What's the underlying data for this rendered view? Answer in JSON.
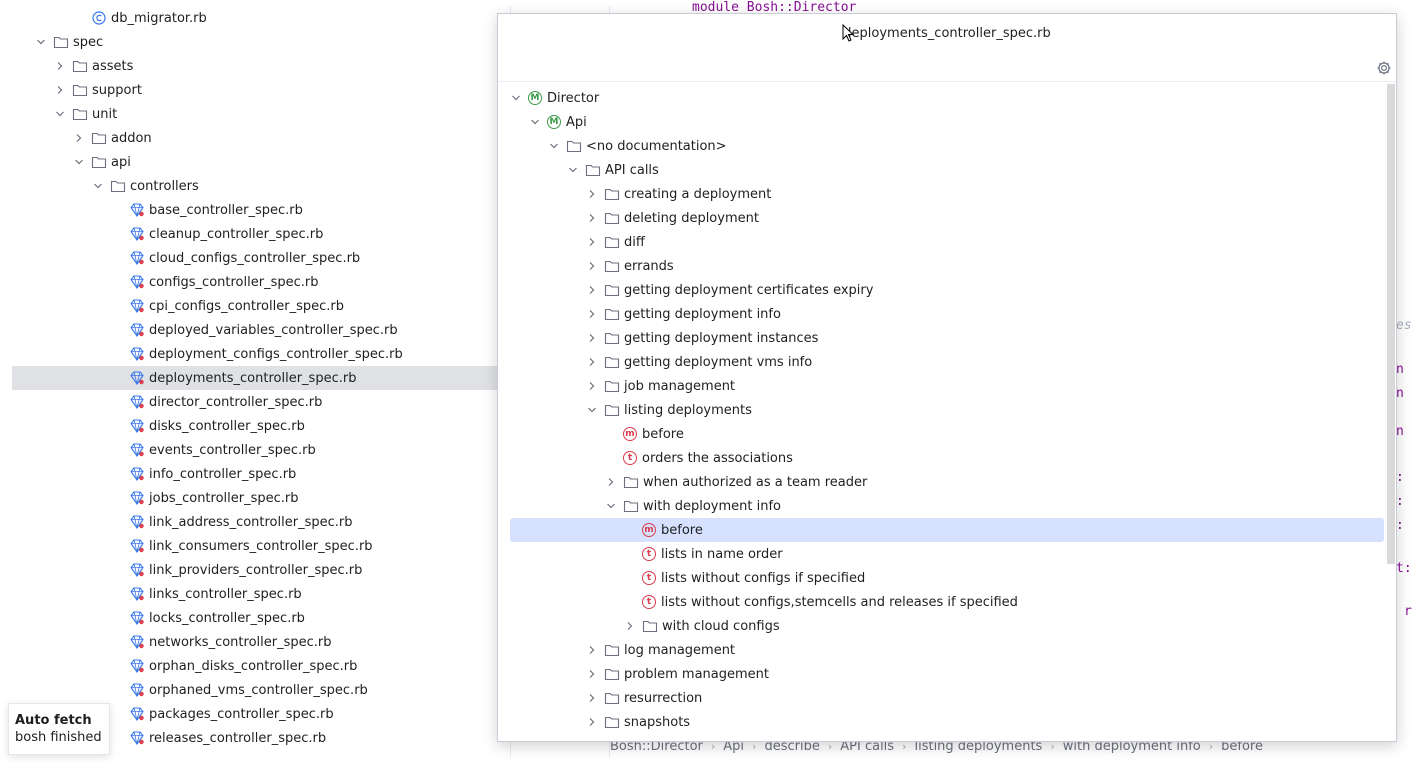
{
  "project_tree": {
    "rows": [
      {
        "label": "db_migrator.rb",
        "kind": "rb-class",
        "indent": 4,
        "chev": "none"
      },
      {
        "label": "spec",
        "kind": "folder",
        "indent": 2,
        "chev": "open"
      },
      {
        "label": "assets",
        "kind": "folder",
        "indent": 3,
        "chev": "closed"
      },
      {
        "label": "support",
        "kind": "folder",
        "indent": 3,
        "chev": "closed"
      },
      {
        "label": "unit",
        "kind": "folder",
        "indent": 3,
        "chev": "open"
      },
      {
        "label": "addon",
        "kind": "folder",
        "indent": 4,
        "chev": "closed"
      },
      {
        "label": "api",
        "kind": "folder",
        "indent": 4,
        "chev": "open"
      },
      {
        "label": "controllers",
        "kind": "folder",
        "indent": 5,
        "chev": "open"
      },
      {
        "label": "base_controller_spec.rb",
        "kind": "spec",
        "indent": 6,
        "chev": "none"
      },
      {
        "label": "cleanup_controller_spec.rb",
        "kind": "spec",
        "indent": 6,
        "chev": "none"
      },
      {
        "label": "cloud_configs_controller_spec.rb",
        "kind": "spec",
        "indent": 6,
        "chev": "none"
      },
      {
        "label": "configs_controller_spec.rb",
        "kind": "spec",
        "indent": 6,
        "chev": "none"
      },
      {
        "label": "cpi_configs_controller_spec.rb",
        "kind": "spec",
        "indent": 6,
        "chev": "none"
      },
      {
        "label": "deployed_variables_controller_spec.rb",
        "kind": "spec",
        "indent": 6,
        "chev": "none"
      },
      {
        "label": "deployment_configs_controller_spec.rb",
        "kind": "spec",
        "indent": 6,
        "chev": "none"
      },
      {
        "label": "deployments_controller_spec.rb",
        "kind": "spec",
        "indent": 6,
        "chev": "none",
        "selected": true
      },
      {
        "label": "director_controller_spec.rb",
        "kind": "spec",
        "indent": 6,
        "chev": "none"
      },
      {
        "label": "disks_controller_spec.rb",
        "kind": "spec",
        "indent": 6,
        "chev": "none"
      },
      {
        "label": "events_controller_spec.rb",
        "kind": "spec",
        "indent": 6,
        "chev": "none"
      },
      {
        "label": "info_controller_spec.rb",
        "kind": "spec",
        "indent": 6,
        "chev": "none"
      },
      {
        "label": "jobs_controller_spec.rb",
        "kind": "spec",
        "indent": 6,
        "chev": "none"
      },
      {
        "label": "link_address_controller_spec.rb",
        "kind": "spec",
        "indent": 6,
        "chev": "none"
      },
      {
        "label": "link_consumers_controller_spec.rb",
        "kind": "spec",
        "indent": 6,
        "chev": "none"
      },
      {
        "label": "link_providers_controller_spec.rb",
        "kind": "spec",
        "indent": 6,
        "chev": "none"
      },
      {
        "label": "links_controller_spec.rb",
        "kind": "spec",
        "indent": 6,
        "chev": "none"
      },
      {
        "label": "locks_controller_spec.rb",
        "kind": "spec",
        "indent": 6,
        "chev": "none"
      },
      {
        "label": "networks_controller_spec.rb",
        "kind": "spec",
        "indent": 6,
        "chev": "none"
      },
      {
        "label": "orphan_disks_controller_spec.rb",
        "kind": "spec",
        "indent": 6,
        "chev": "none"
      },
      {
        "label": "orphaned_vms_controller_spec.rb",
        "kind": "spec",
        "indent": 6,
        "chev": "none"
      },
      {
        "label": "packages_controller_spec.rb",
        "kind": "spec",
        "indent": 6,
        "chev": "none"
      },
      {
        "label": "releases_controller_spec.rb",
        "kind": "spec",
        "indent": 6,
        "chev": "none"
      }
    ]
  },
  "editor": {
    "top_code": "module Bosh::Director",
    "right_fragments": [
      "es",
      "n",
      "n",
      "n",
      ":",
      ":",
      ":",
      "t:",
      "r"
    ]
  },
  "structure_popup": {
    "title": "deployments_controller_spec.rb",
    "rows": [
      {
        "label": "Director",
        "kind": "module",
        "indent": 0,
        "chev": "open"
      },
      {
        "label": "Api",
        "kind": "module",
        "indent": 1,
        "chev": "open"
      },
      {
        "label": "<no documentation>",
        "kind": "folder",
        "indent": 2,
        "chev": "open"
      },
      {
        "label": "API calls",
        "kind": "folder",
        "indent": 3,
        "chev": "open"
      },
      {
        "label": "creating a deployment",
        "kind": "folder",
        "indent": 4,
        "chev": "closed"
      },
      {
        "label": "deleting deployment",
        "kind": "folder",
        "indent": 4,
        "chev": "closed"
      },
      {
        "label": "diff",
        "kind": "folder",
        "indent": 4,
        "chev": "closed"
      },
      {
        "label": "errands",
        "kind": "folder",
        "indent": 4,
        "chev": "closed"
      },
      {
        "label": "getting deployment certificates expiry",
        "kind": "folder",
        "indent": 4,
        "chev": "closed"
      },
      {
        "label": "getting deployment info",
        "kind": "folder",
        "indent": 4,
        "chev": "closed"
      },
      {
        "label": "getting deployment instances",
        "kind": "folder",
        "indent": 4,
        "chev": "closed"
      },
      {
        "label": "getting deployment vms info",
        "kind": "folder",
        "indent": 4,
        "chev": "closed"
      },
      {
        "label": "job management",
        "kind": "folder",
        "indent": 4,
        "chev": "closed"
      },
      {
        "label": "listing deployments",
        "kind": "folder",
        "indent": 4,
        "chev": "open"
      },
      {
        "label": "before",
        "kind": "method",
        "indent": 5,
        "chev": "none"
      },
      {
        "label": "orders the associations",
        "kind": "test",
        "indent": 5,
        "chev": "none"
      },
      {
        "label": "when authorized as a team reader",
        "kind": "folder",
        "indent": 5,
        "chev": "closed"
      },
      {
        "label": "with deployment info",
        "kind": "folder",
        "indent": 5,
        "chev": "open"
      },
      {
        "label": "before",
        "kind": "method",
        "indent": 6,
        "chev": "none",
        "selected": true
      },
      {
        "label": "lists in name order",
        "kind": "test",
        "indent": 6,
        "chev": "none"
      },
      {
        "label": "lists without configs if specified",
        "kind": "test",
        "indent": 6,
        "chev": "none"
      },
      {
        "label": "lists without configs,stemcells and releases if specified",
        "kind": "test",
        "indent": 6,
        "chev": "none"
      },
      {
        "label": "with cloud configs",
        "kind": "folder",
        "indent": 6,
        "chev": "closed"
      },
      {
        "label": "log management",
        "kind": "folder",
        "indent": 4,
        "chev": "closed"
      },
      {
        "label": "problem management",
        "kind": "folder",
        "indent": 4,
        "chev": "closed"
      },
      {
        "label": "resurrection",
        "kind": "folder",
        "indent": 4,
        "chev": "closed"
      },
      {
        "label": "snapshots",
        "kind": "folder",
        "indent": 4,
        "chev": "closed"
      }
    ]
  },
  "breadcrumb": [
    "Bosh::Director",
    "Api",
    "describe",
    "API calls",
    "listing deployments",
    "with deployment info",
    "before"
  ],
  "toast": {
    "line1": "Auto fetch",
    "line2": "bosh finished"
  },
  "colors": {
    "selection_popup": "#d5e1ff",
    "selection_tree": "#dfe1e5",
    "module_green": "#3a9b45",
    "test_red": "#db3b4b"
  }
}
